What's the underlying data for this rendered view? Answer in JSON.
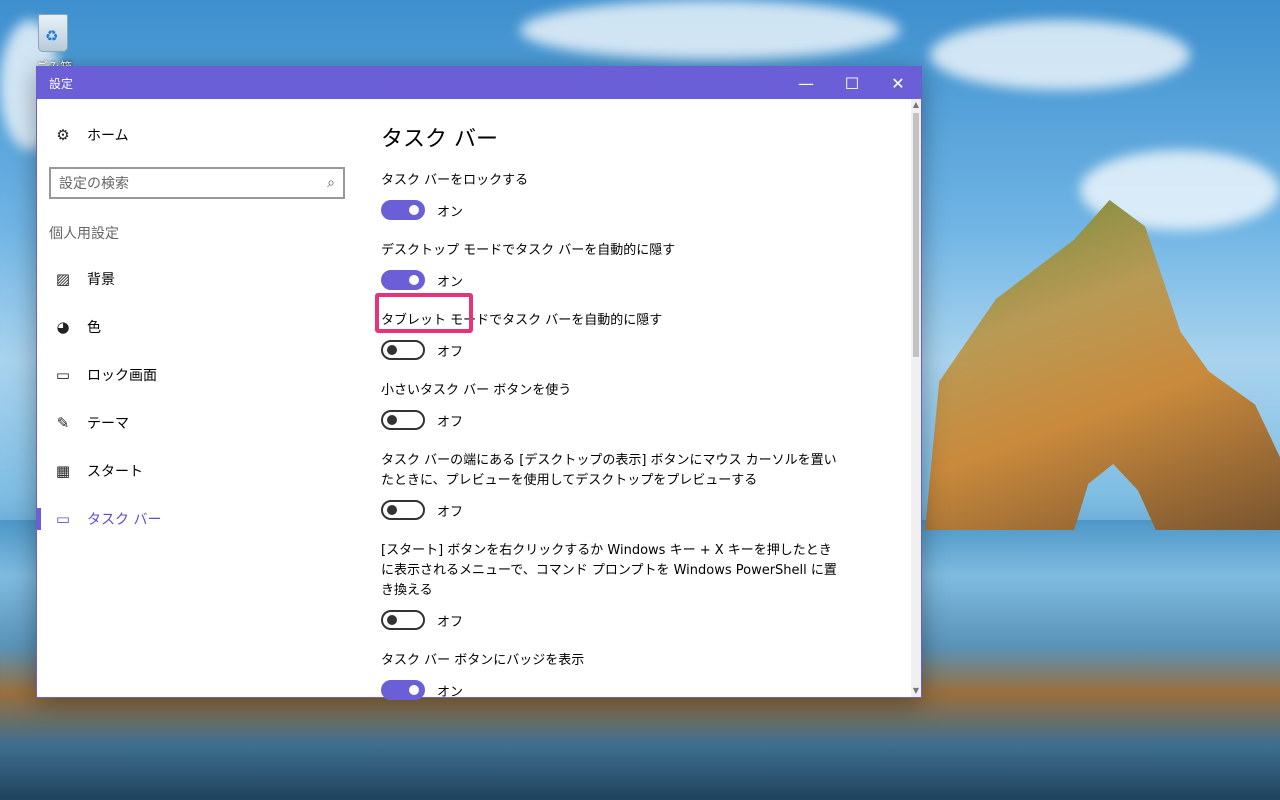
{
  "desktop": {
    "recycle_label": "ごみ箱"
  },
  "window": {
    "title": "設定",
    "controls": {
      "minimize": "—",
      "maximize": "☐",
      "close": "✕"
    }
  },
  "sidebar": {
    "home_label": "ホーム",
    "search_placeholder": "設定の検索",
    "section_label": "個人用設定",
    "items": [
      {
        "label": "背景",
        "icon": "image-icon"
      },
      {
        "label": "色",
        "icon": "palette-icon"
      },
      {
        "label": "ロック画面",
        "icon": "lock-screen-icon"
      },
      {
        "label": "テーマ",
        "icon": "theme-icon"
      },
      {
        "label": "スタート",
        "icon": "start-icon"
      },
      {
        "label": "タスク バー",
        "icon": "taskbar-icon",
        "active": true
      }
    ]
  },
  "content": {
    "title": "タスク バー",
    "settings": [
      {
        "label": "タスク バーをロックする",
        "state": "オン",
        "on": true
      },
      {
        "label": "デスクトップ モードでタスク バーを自動的に隠す",
        "state": "オン",
        "on": true
      },
      {
        "label": "タブレット モードでタスク バーを自動的に隠す",
        "state": "オフ",
        "on": false
      },
      {
        "label": "小さいタスク バー ボタンを使う",
        "state": "オフ",
        "on": false
      },
      {
        "label": "タスク バーの端にある [デスクトップの表示] ボタンにマウス カーソルを置いたときに、プレビューを使用してデスクトップをプレビューする",
        "state": "オフ",
        "on": false
      },
      {
        "label": "[スタート] ボタンを右クリックするか Windows キー + X キーを押したときに表示されるメニューで、コマンド プロンプトを Windows PowerShell に置き換える",
        "state": "オフ",
        "on": false
      },
      {
        "label": "タスク バー ボタンにバッジを表示",
        "state": "オン",
        "on": true
      }
    ]
  },
  "colors": {
    "accent": "#6b5fd8",
    "highlight": "#e8337a"
  }
}
